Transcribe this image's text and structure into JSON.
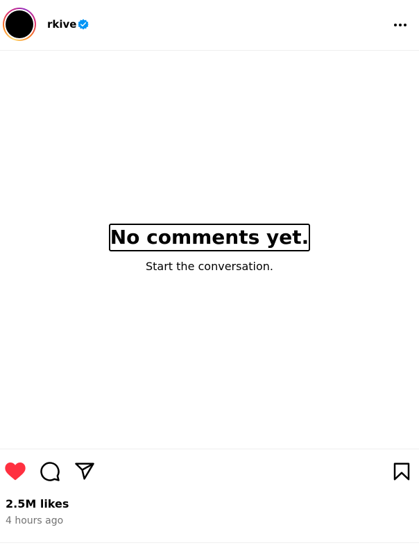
{
  "header": {
    "username": "rkive",
    "verified": true,
    "avatar_icon": "profile-avatar",
    "more_icon": "more-horizontal-icon"
  },
  "comments": {
    "empty_title": "No comments yet.",
    "empty_subtitle": "Start the conversation."
  },
  "actions": {
    "like_icon": "heart-filled-icon",
    "comment_icon": "comment-icon",
    "share_icon": "share-icon",
    "save_icon": "bookmark-icon",
    "liked": true
  },
  "stats": {
    "likes": "2.5M likes",
    "timestamp": "4 hours ago"
  },
  "colors": {
    "like_red": "#ff3040",
    "verified_blue": "#0095f6",
    "muted_text": "#737373",
    "divider": "#efefef"
  }
}
